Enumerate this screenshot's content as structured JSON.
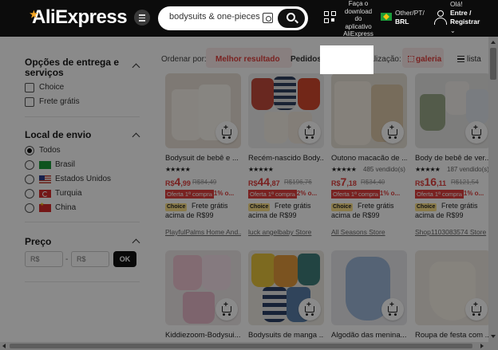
{
  "header": {
    "logo": "AliExpress",
    "search_value": "bodysuits & one-pieces",
    "app_download": "Faça o download do aplicativo AliExpress",
    "locale_top": "Other/PT/",
    "locale_bottom": "BRL",
    "greeting": "Olá!",
    "signin": "Entre / Registrar"
  },
  "sidebar": {
    "delivery_title": "Opções de entrega e serviços",
    "delivery_options": [
      "Choice",
      "Frete grátis"
    ],
    "ship_from_title": "Local de envio",
    "ship_from_options": [
      "Todos",
      "Brasil",
      "Estados Unidos",
      "Turquia",
      "China"
    ],
    "ship_from_selected": "Todos",
    "price_title": "Preço",
    "price_min_placeholder": "R$",
    "price_max_placeholder": "R$",
    "price_ok": "OK"
  },
  "sortbar": {
    "sort_label": "Ordenar por:",
    "sort_best": "Melhor resultado",
    "sort_orders": "Pedidos",
    "view_label": "Visualização:",
    "view_gallery": "galeria",
    "view_list": "lista"
  },
  "products": [
    {
      "title": "Bodysuit de bebê e ...",
      "stars": "★★★★★",
      "sold": "",
      "currency": "R$",
      "price_int": "4",
      "price_dec": ",99",
      "old_price": "R$84,49",
      "offer": "Oferta 1ª compra",
      "offer_extra": "· 1% o...",
      "choice": "Choice",
      "ship_line1": "Frete grátis",
      "ship_line2": "acima de R$99",
      "store": "PlayfulPalms Home And..."
    },
    {
      "title": "Recém-nascido Body...",
      "stars": "★★★★★",
      "sold": "",
      "currency": "R$",
      "price_int": "44",
      "price_dec": ",87",
      "old_price": "R$196,76",
      "offer": "Oferta 1ª compra",
      "offer_extra": "· 2% o...",
      "choice": "Choice",
      "ship_line1": "Frete grátis",
      "ship_line2": "acima de R$99",
      "store": "luck angelbaby Store"
    },
    {
      "title": "Outono macacão de ...",
      "stars": "★★★★★",
      "sold": "485 vendido(s)",
      "currency": "R$",
      "price_int": "7",
      "price_dec": ",18",
      "old_price": "R$34,40",
      "offer": "Oferta 1ª compra",
      "offer_extra": "· 1% o...",
      "choice": "Choice",
      "ship_line1": "Frete grátis",
      "ship_line2": "acima de R$99",
      "store": "All Seasons Store"
    },
    {
      "title": "Body de bebê de ver...",
      "stars": "★★★★★",
      "sold": "187 vendido(s)",
      "currency": "R$",
      "price_int": "16",
      "price_dec": ",11",
      "old_price": "R$121,54",
      "offer": "Oferta 1ª compra",
      "offer_extra": "· 1% o...",
      "choice": "Choice",
      "ship_line1": "Frete grátis",
      "ship_line2": "acima de R$99",
      "store": "Shop1103083574 Store"
    },
    {
      "title": "Kiddiezoom-Bodysui..."
    },
    {
      "title": "Bodysuits de manga ..."
    },
    {
      "title": "Algodão das menina..."
    },
    {
      "title": "Roupa de festa com ..."
    }
  ],
  "colors": {
    "accent": "#e0403d",
    "header_bg": "#0c0c0c",
    "choice_badge": "#fde28a"
  }
}
